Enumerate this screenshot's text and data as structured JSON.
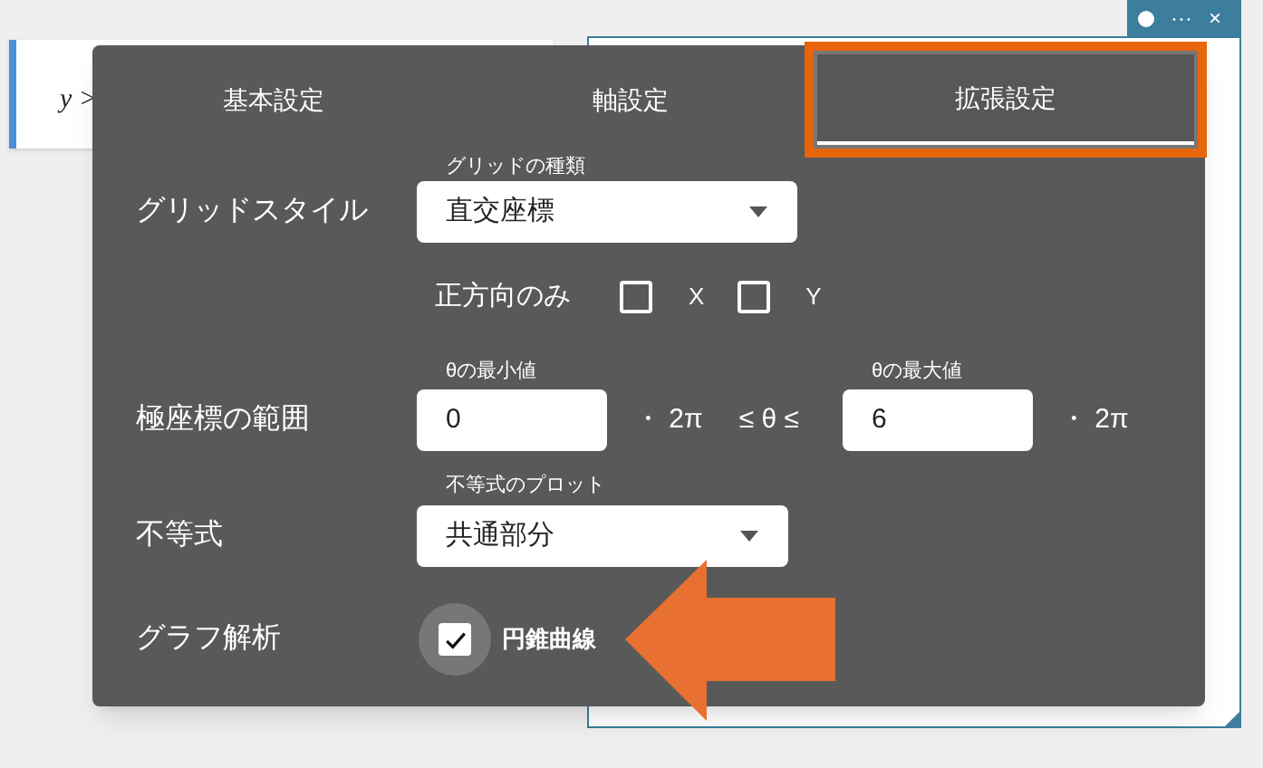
{
  "expression": {
    "text": "y >"
  },
  "graph_window": {
    "more": "···",
    "close": "×"
  },
  "dialog": {
    "tabs": [
      {
        "label": "基本設定",
        "selected": false
      },
      {
        "label": "軸設定",
        "selected": false
      },
      {
        "label": "拡張設定",
        "selected": true
      }
    ],
    "grid_style": {
      "label": "グリッドスタイル",
      "caption": "グリッドの種類",
      "value": "直交座標"
    },
    "positive_only": {
      "label": "正方向のみ",
      "options": [
        {
          "label": "X",
          "checked": false
        },
        {
          "label": "Y",
          "checked": false
        }
      ]
    },
    "polar_range": {
      "label": "極座標の範囲",
      "min_caption": "θの最小値",
      "min_value": "0",
      "min_unit": "・ 2π",
      "relation": "≤ θ ≤",
      "max_caption": "θの最大値",
      "max_value": "6",
      "max_unit": "・ 2π"
    },
    "inequality": {
      "label": "不等式",
      "caption": "不等式のプロット",
      "value": "共通部分"
    },
    "graph_analysis": {
      "label": "グラフ解析",
      "option": {
        "label": "円錐曲線",
        "checked": true
      }
    }
  }
}
